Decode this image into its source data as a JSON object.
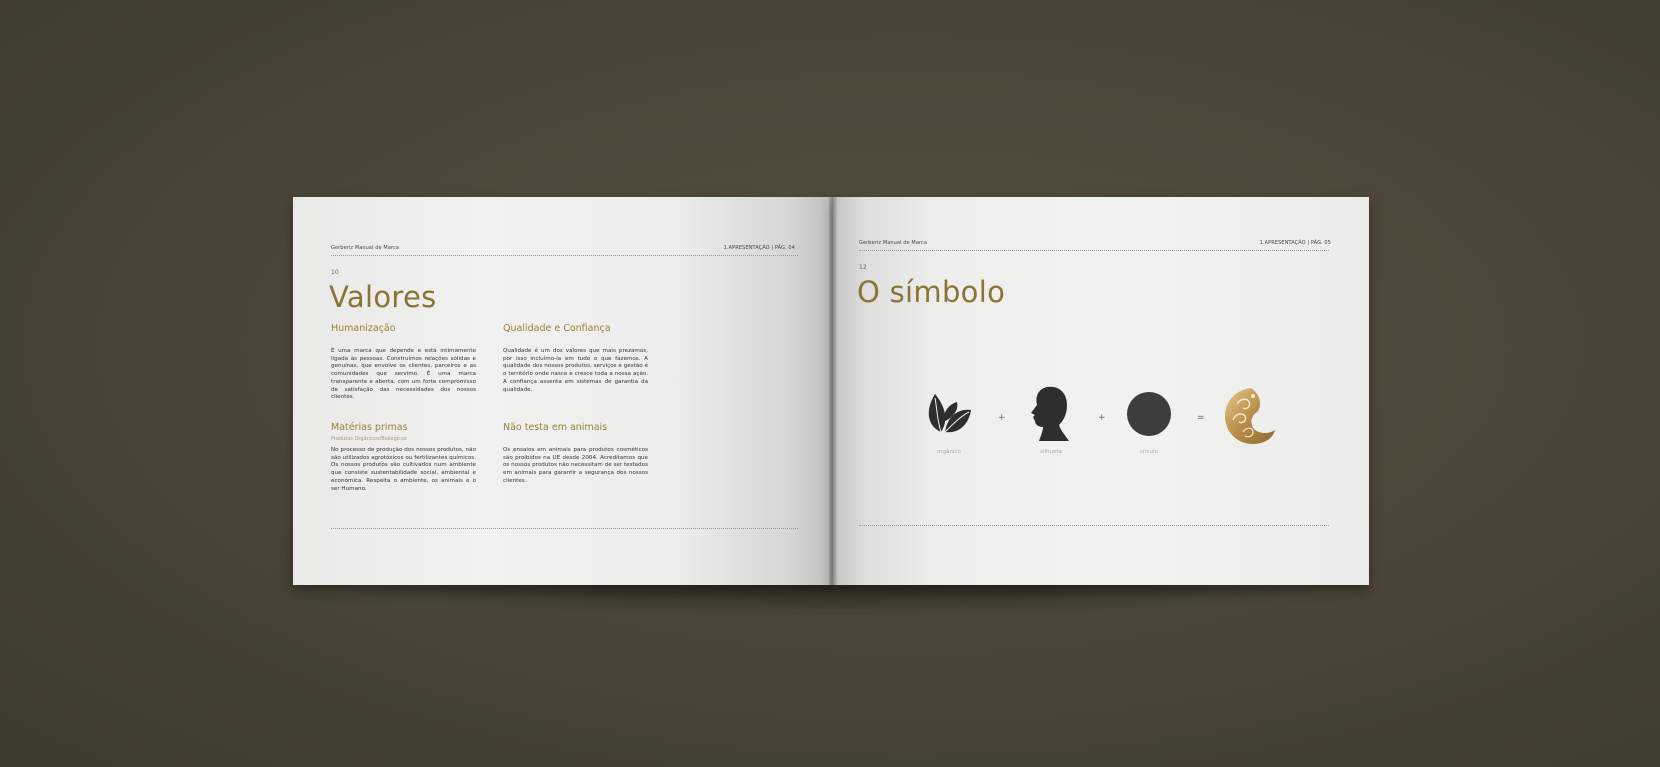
{
  "left_page": {
    "header_left": "Gerberiz Manual de Marca",
    "header_right": "1.APRESENTAÇÃO | PÁG. 04",
    "page_number": "10",
    "title": "Valores",
    "sections": [
      {
        "heading": "Humanização",
        "subheading": "",
        "body": "É uma marca que depende e está intimamente ligada às pessoas. Construímos relações sólidas e genuínas, que envolve os clientes, parceiros e as comunidades que servimo. É uma marca transparente e aberta, com um forte compromisso de satisfação das necessidades dos nossos clientes."
      },
      {
        "heading": "Qualidade e Confiança",
        "subheading": "",
        "body": "Qualidade é um dos valores que mais prezamos, por isso incluímo-la em tudo o que fazemos. A qualidade dos nossos produtos, serviços e gestão é o território onde nasce e cresce toda a nossa ação. A confiança assenta em sistemas de garantia da qualidade."
      },
      {
        "heading": "Matérias primas",
        "subheading": "Produtos Orgânicos/Biológicos",
        "body": "No processo de produção dos nossos produtos, não são utilizados agrotóxicos ou fertilizantes químicos. Os nossos produtos são cultivados num ambiente que consiste sustentabilidade social, ambiental e económica. Respeita o ambiente, os animais e o ser Humano."
      },
      {
        "heading": "Não testa em animais",
        "subheading": "",
        "body": "Os ensaios em animais para produtos cosméticos são proibidos na UE desde 2004. Acreditamos que os nossos produtos não necessitam de ser testados em animais para garantir a segurança dos nossos clientes."
      }
    ]
  },
  "right_page": {
    "header_left": "Gerberiz Manual de Marca",
    "header_right": "1.APRESENTAÇÃO | PÁG. 05",
    "page_number": "12",
    "title": "O símbolo",
    "equation": {
      "items": [
        {
          "icon": "leaves-icon",
          "label": "orgânico"
        },
        {
          "icon": "silhouette-icon",
          "label": "silhueta"
        },
        {
          "icon": "circle-icon",
          "label": "círculo"
        }
      ],
      "plus": "+",
      "equals": "=",
      "result_icon": "gerberiz-symbol-icon"
    }
  },
  "colors": {
    "background": "#4d4739",
    "accent_gold": "#8b7436",
    "icon_dark": "#2e2e2e",
    "circle_dark": "#3d3d3d"
  }
}
